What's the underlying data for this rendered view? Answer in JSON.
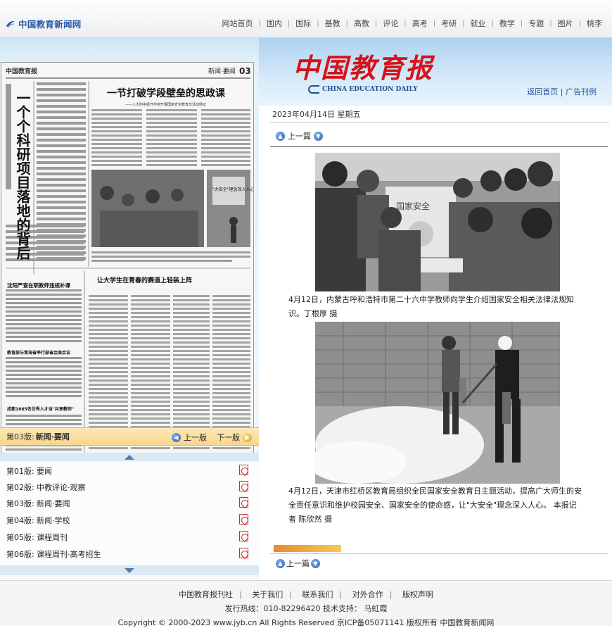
{
  "site": {
    "logo_text": "中国教育新闻网",
    "nav": [
      "网站首页",
      "国内",
      "国际",
      "基教",
      "高教",
      "评论",
      "高考",
      "考研",
      "就业",
      "教学",
      "专题",
      "图片",
      "桃李"
    ]
  },
  "masthead": {
    "title": "中国教育报",
    "subtitle": "CHINA EDUCATION DAILY",
    "links": "返回首页 | 广告刊例"
  },
  "date": "2023年04月14日 星期五",
  "newspaper": {
    "header_left": "中国教育报",
    "header_right": "新闻·要闻",
    "page_num": "03",
    "headline1": "一节打破学段壁垒的思政课",
    "headline1_sub": "——人大附中经开学校开展国家安全教育日活动侧记",
    "vertical_headline": "一个个科研项目落地的背后",
    "inset_label": "\"大安全\"理念深入人心",
    "headline2": "让大学生在青春的赛道上轻装上阵",
    "side_head1": "沈阳严查在职教师违规补课",
    "side_head2": "教育部与青海省举行部省会商会议",
    "side_head3": "成都1665名优秀人才当\"共享教师\""
  },
  "page_bar": {
    "label": "第03版:",
    "name": "新闻·要闻",
    "prev": "上一版",
    "next": "下一版"
  },
  "editions": [
    {
      "label": "第01版:",
      "name": "要闻"
    },
    {
      "label": "第02版:",
      "name": "中教评论·观察"
    },
    {
      "label": "第03版:",
      "name": "新闻·要闻"
    },
    {
      "label": "第04版:",
      "name": "新闻·学校"
    },
    {
      "label": "第05版:",
      "name": "课程周刊"
    },
    {
      "label": "第06版:",
      "name": "课程周刊·高考招生"
    }
  ],
  "article": {
    "prev_label": "上一篇",
    "caption1": "4月12日，内蒙古呼和浩特市第二十六中学教师向学生介绍国家安全相关法律法规知识。丁根厚 摄",
    "caption2": "4月12日，天津市红桥区教育局组织全民国家安全教育日主题活动，提高广大师生的安全责任意识和维护校园安全、国家安全的使命感，让\"大安全\"理念深入人心。 本报记者 陈欣然 摄",
    "photo1_sign": "国家安全",
    "bottom_prev_label": "上一篇"
  },
  "footer": {
    "links": [
      "中国教育报刊社",
      "关于我们",
      "联系我们",
      "对外合作",
      "版权声明"
    ],
    "hotline": "发行热线：010-82296420 技术支持： 马虹霞",
    "copyright": "Copyright © 2000-2023 www.jyb.cn All Rights Reserved 京ICP备05071141 版权所有 中国教育新闻网"
  }
}
